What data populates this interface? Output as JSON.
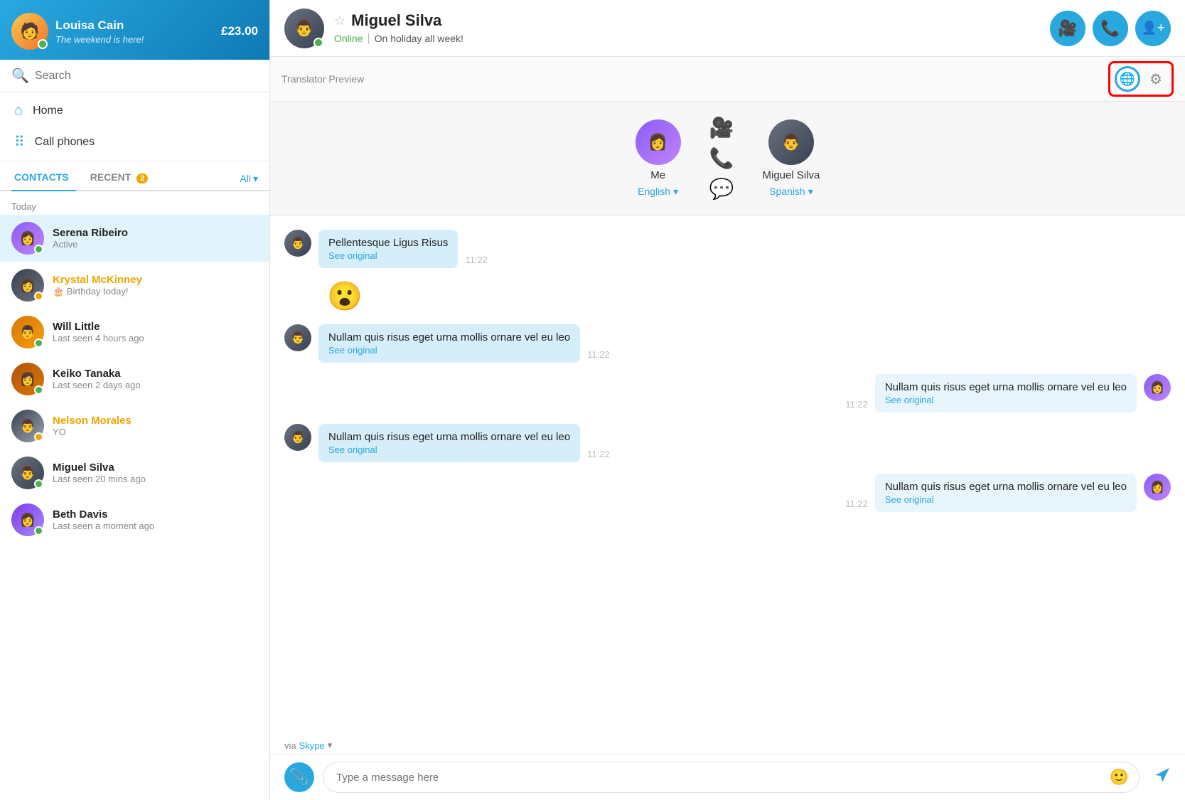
{
  "sidebar": {
    "user": {
      "name": "Louisa Cain",
      "status": "The weekend is here!",
      "balance": "£23.00"
    },
    "search_placeholder": "Search",
    "nav": [
      {
        "id": "home",
        "label": "Home",
        "icon": "⌂"
      },
      {
        "id": "call-phones",
        "label": "Call phones",
        "icon": "⠿"
      }
    ],
    "tabs": [
      {
        "id": "contacts",
        "label": "CONTACTS",
        "active": true
      },
      {
        "id": "recent",
        "label": "RECENT",
        "badge": "2"
      }
    ],
    "tab_all": "All",
    "section_today": "Today",
    "contacts": [
      {
        "id": "serena",
        "name": "Serena Ribeiro",
        "status": "Active",
        "dot": "green",
        "active": true,
        "nameClass": ""
      },
      {
        "id": "krystal",
        "name": "Krystal McKinney",
        "status": "🎂 Birthday today!",
        "dot": "yellow",
        "active": false,
        "nameClass": "orange"
      },
      {
        "id": "will",
        "name": "Will Little",
        "status": "Last seen 4 hours ago",
        "dot": "green",
        "active": false,
        "nameClass": ""
      },
      {
        "id": "keiko",
        "name": "Keiko Tanaka",
        "status": "Last seen 2 days ago",
        "dot": "green",
        "active": false,
        "nameClass": ""
      },
      {
        "id": "nelson",
        "name": "Nelson Morales",
        "status": "YO",
        "dot": "yellow",
        "active": false,
        "nameClass": "orange"
      },
      {
        "id": "miguel",
        "name": "Miguel Silva",
        "status": "Last seen 20 mins ago",
        "dot": "green",
        "active": false,
        "nameClass": ""
      },
      {
        "id": "beth",
        "name": "Beth Davis",
        "status": "Last seen a moment ago",
        "dot": "green",
        "active": false,
        "nameClass": ""
      }
    ]
  },
  "chat": {
    "contact_name": "Miguel Silva",
    "online_label": "Online",
    "status_text": "On holiday all week!",
    "actions": {
      "video": "📹",
      "call": "📞",
      "add_contact": "👤+"
    }
  },
  "translator": {
    "preview_label": "Translator Preview",
    "me": {
      "name": "Me",
      "lang": "English",
      "dropdown_icon": "▾"
    },
    "contact": {
      "name": "Miguel Silva",
      "lang": "Spanish",
      "dropdown_icon": "▾"
    },
    "icon_globe": "🌐",
    "icon_gear": "⚙"
  },
  "messages": [
    {
      "id": 1,
      "side": "left",
      "text": "Pellentesque Ligus Risus",
      "see_original": "See original",
      "time": "11:22"
    },
    {
      "id": 2,
      "side": "left",
      "emoji": "😮",
      "isEmoji": true
    },
    {
      "id": 3,
      "side": "left",
      "text": "Nullam quis risus eget urna mollis ornare vel eu leo",
      "see_original": "See original",
      "time": "11:22"
    },
    {
      "id": 4,
      "side": "right",
      "text": "Nullam quis risus eget urna mollis ornare vel eu leo",
      "see_original": "See original",
      "time": "11:22"
    },
    {
      "id": 5,
      "side": "left",
      "text": "Nullam quis risus eget urna mollis ornare vel eu leo",
      "see_original": "See original",
      "time": "11:22"
    },
    {
      "id": 6,
      "side": "right",
      "text": "Nullam quis risus eget urna mollis ornare vel eu leo",
      "see_original": "See original",
      "time": "11:22"
    }
  ],
  "via": {
    "label": "via",
    "link": "Skype",
    "dropdown": "▾"
  },
  "input": {
    "placeholder": "Type a message here"
  }
}
